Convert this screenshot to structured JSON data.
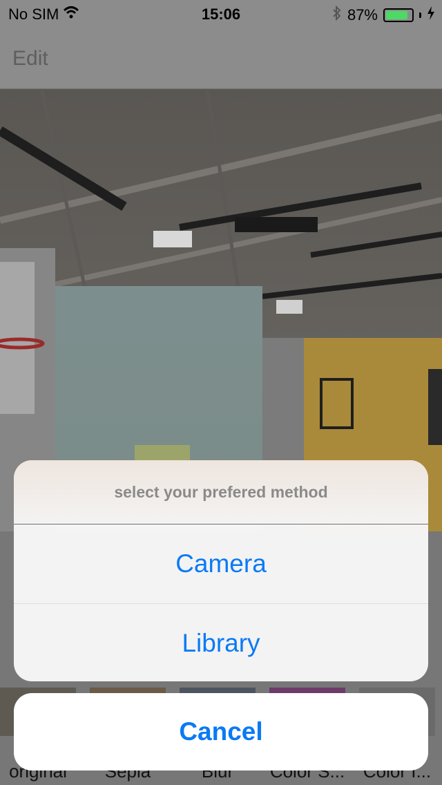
{
  "status_bar": {
    "carrier": "No SIM",
    "time": "15:06",
    "battery": "87%",
    "battery_level": 0.87,
    "icons": [
      "wifi-icon",
      "bluetooth-icon",
      "battery-icon",
      "charging-bolt-icon"
    ]
  },
  "nav": {
    "edit_label": "Edit"
  },
  "photo": {
    "description_icon": "gym-photo"
  },
  "filters": [
    {
      "label": "original"
    },
    {
      "label": "Sepia"
    },
    {
      "label": "Blur"
    },
    {
      "label": "Color S..."
    },
    {
      "label": "Color I..."
    }
  ],
  "action_sheet": {
    "title": "select your prefered method",
    "options": [
      {
        "label": "Camera"
      },
      {
        "label": "Library"
      }
    ],
    "cancel_label": "Cancel"
  },
  "colors": {
    "accent": "#0a7af5",
    "battery": "#4cd964"
  }
}
